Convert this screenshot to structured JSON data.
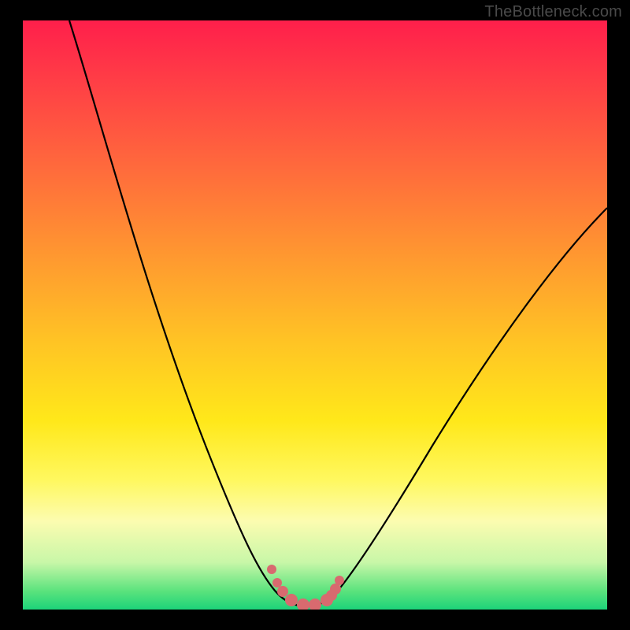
{
  "watermark": "TheBottleneck.com",
  "colors": {
    "frame_border": "#000000",
    "curve_stroke": "#000000",
    "marker_fill": "#d86a6f",
    "gradient_stops": [
      "#ff1f4b",
      "#ff3d46",
      "#ff6a3c",
      "#ff9830",
      "#ffc524",
      "#ffe81a",
      "#fff85f",
      "#fcfcb0",
      "#c8f7a8",
      "#58e27c",
      "#1cd37a"
    ]
  },
  "chart_data": {
    "type": "line",
    "title": "",
    "xlabel": "",
    "ylabel": "",
    "xlim": [
      0,
      100
    ],
    "ylim": [
      0,
      100
    ],
    "grid": false,
    "legend": false,
    "series": [
      {
        "name": "bottleneck-curve",
        "x": [
          8,
          10,
          12,
          14,
          16,
          18,
          20,
          22,
          24,
          26,
          28,
          30,
          32,
          34,
          36,
          38,
          40,
          42,
          43,
          44,
          45,
          46,
          47,
          48,
          49,
          50,
          51,
          52,
          53,
          55,
          58,
          62,
          66,
          70,
          74,
          78,
          82,
          86,
          90,
          94,
          98,
          100
        ],
        "values": [
          100,
          95,
          90,
          85,
          80,
          75,
          69,
          63,
          57,
          51,
          45,
          39,
          33,
          27,
          22,
          17,
          12,
          8,
          6,
          4,
          3,
          2,
          1,
          0.5,
          0.5,
          0.5,
          1,
          2,
          3,
          6,
          11,
          17,
          23,
          29,
          35,
          41,
          47,
          53,
          58,
          62,
          66,
          68
        ]
      }
    ],
    "markers": {
      "name": "highlight-points",
      "x": [
        42.5,
        43.5,
        44.5,
        46,
        48,
        50,
        52,
        52.8,
        53.5,
        54.2
      ],
      "values": [
        6.5,
        4.2,
        2.8,
        1.2,
        0.6,
        0.6,
        1.4,
        2.2,
        3.3,
        4.8
      ]
    }
  }
}
